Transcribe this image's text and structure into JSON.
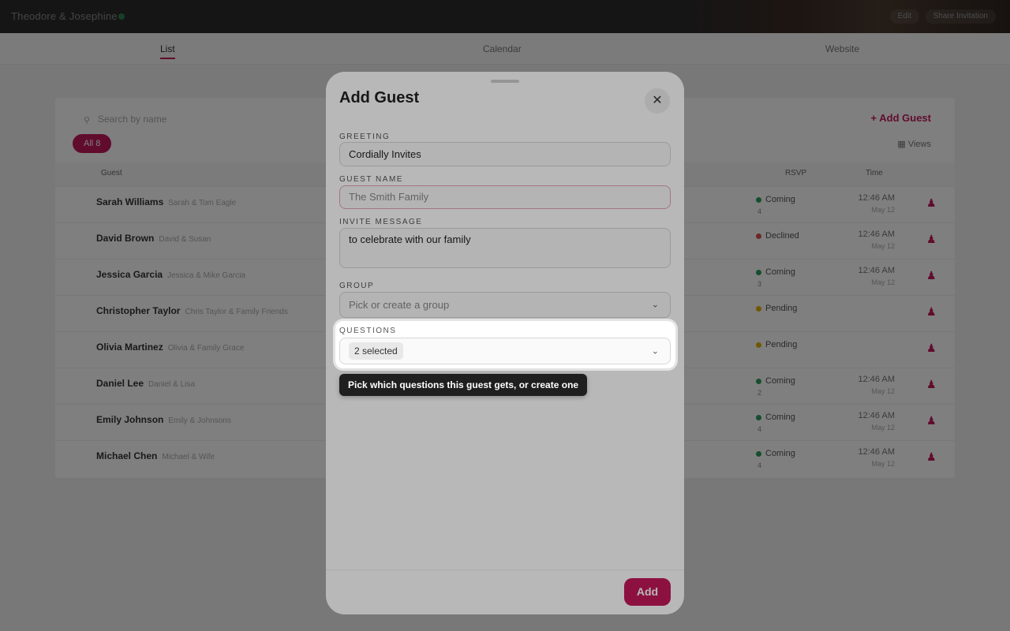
{
  "app": {
    "title": "Theodore & Josephine",
    "edit_label": "Edit",
    "share_label": "Share Invitation"
  },
  "nav": {
    "tabs": [
      {
        "label": "List",
        "active": true
      },
      {
        "label": "Calendar",
        "active": false
      },
      {
        "label": "Website",
        "active": false
      }
    ]
  },
  "guest_list": {
    "search_placeholder": "Search by name",
    "filter_chip": "All 8",
    "add_guest_label": "Add Guest",
    "views_label": "Views",
    "columns": {
      "guest": "Guest",
      "rsvp": "RSVP",
      "time": "Time"
    },
    "rows": [
      {
        "name": "Sarah Williams",
        "sub": "Sarah & Tom Eagle",
        "status": "Coming",
        "status_color": "#2e9d5b",
        "count": "4",
        "time": "12:46 AM",
        "date": "May 12"
      },
      {
        "name": "David Brown",
        "sub": "David & Susan",
        "status": "Declined",
        "status_color": "#d9534f",
        "count": "",
        "time": "12:46 AM",
        "date": "May 12"
      },
      {
        "name": "Jessica Garcia",
        "sub": "Jessica & Mike Garcia",
        "status": "Coming",
        "status_color": "#2e9d5b",
        "count": "3",
        "time": "12:46 AM",
        "date": "May 12"
      },
      {
        "name": "Christopher Taylor",
        "sub": "Chris Taylor & Family Friends",
        "status": "Pending",
        "status_color": "#e0b100",
        "count": "",
        "time": "",
        "date": ""
      },
      {
        "name": "Olivia Martinez",
        "sub": "Olivia & Family Grace",
        "status": "Pending",
        "status_color": "#e0b100",
        "count": "",
        "time": "",
        "date": ""
      },
      {
        "name": "Daniel Lee",
        "sub": "Daniel & Lisa",
        "status": "Coming",
        "status_color": "#2e9d5b",
        "count": "2",
        "time": "12:46 AM",
        "date": "May 12"
      },
      {
        "name": "Emily Johnson",
        "sub": "Emily & Johnsons",
        "status": "Coming",
        "status_color": "#2e9d5b",
        "count": "4",
        "time": "12:46 AM",
        "date": "May 12"
      },
      {
        "name": "Michael Chen",
        "sub": "Michael & Wife",
        "status": "Coming",
        "status_color": "#2e9d5b",
        "count": "4",
        "time": "12:46 AM",
        "date": "May 12"
      }
    ]
  },
  "modal": {
    "title": "Add Guest",
    "close_icon": "close-icon",
    "greeting": {
      "label": "GREETING",
      "value": "Cordially Invites"
    },
    "guest_name": {
      "label": "GUEST NAME",
      "placeholder": "The Smith Family"
    },
    "invite_message": {
      "label": "INVITE MESSAGE",
      "value": "to celebrate with our family"
    },
    "group": {
      "label": "GROUP",
      "placeholder": "Pick or create a group"
    },
    "questions": {
      "label": "QUESTIONS",
      "selected_tag": "2 selected"
    },
    "tooltip": "Pick which questions this guest gets, or create one",
    "add_button": "Add"
  },
  "colors": {
    "accent": "#c2185b",
    "topbar": "#2b2b2b"
  }
}
